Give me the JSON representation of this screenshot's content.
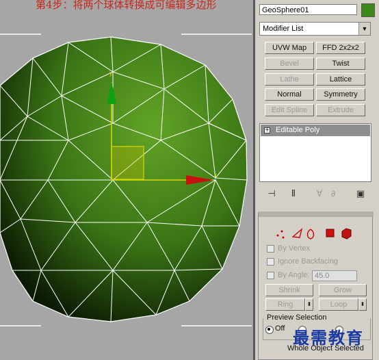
{
  "caption": "第4步：将两个球体转换成可编辑多边形",
  "viewport": {
    "axis_y_label": "y",
    "axis_x_label": "x",
    "sphere_color_center": "#62a427",
    "sphere_color_edge": "#0c1a04"
  },
  "panel": {
    "object_name": "GeoSphere01",
    "object_color": "#3a8a1a",
    "modifier_list_label": "Modifier List",
    "buttons": [
      {
        "label": "UVW Map",
        "enabled": true
      },
      {
        "label": "FFD 2x2x2",
        "enabled": true
      },
      {
        "label": "Bevel",
        "enabled": false
      },
      {
        "label": "Twist",
        "enabled": true
      },
      {
        "label": "Lathe",
        "enabled": false
      },
      {
        "label": "Lattice",
        "enabled": true
      },
      {
        "label": "Normal",
        "enabled": true
      },
      {
        "label": "Symmetry",
        "enabled": true
      },
      {
        "label": "Edit Spline",
        "enabled": false
      },
      {
        "label": "Extrude",
        "enabled": false
      }
    ],
    "stack_item": "Editable Poly",
    "selection": {
      "by_vertex": "By Vertex",
      "ignore_backfacing": "Ignore Backfacing",
      "by_angle": "By Angle:",
      "angle_value": "45.0",
      "shrink": "Shrink",
      "grow": "Grow",
      "ring": "Ring",
      "loop": "Loop",
      "preview_selection": "Preview Selection",
      "off": "Off",
      "subobj": "SubObj",
      "multi": "Multi",
      "status": "Whole Object Selected"
    }
  },
  "watermark": "最需教育"
}
